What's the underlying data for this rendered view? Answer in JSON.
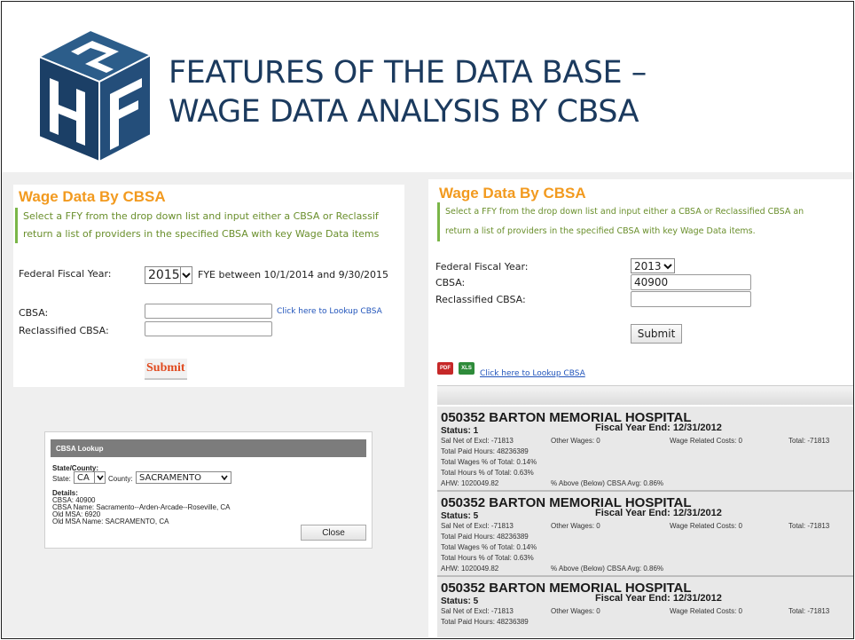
{
  "slide": {
    "title_line1": "FEATURES OF THE DATA BASE –",
    "title_line2": "WAGE DATA ANALYSIS BY CBSA",
    "brand_color": "#1b3a5e",
    "accent_orange": "#f29a1f",
    "accent_green": "#7ab648"
  },
  "panel_a": {
    "heading": "Wage Data By CBSA",
    "desc_line1": "Select a FFY from the drop down list and input either a CBSA or Reclassif",
    "desc_line2": "return a list of providers in the specified CBSA with key Wage Data items",
    "ffy_label": "Federal Fiscal Year:",
    "ffy_value": "2015",
    "fye_note": "FYE between 10/1/2014 and 9/30/2015",
    "cbsa_label": "CBSA:",
    "cbsa_value": "",
    "lookup_link": "Click here to Lookup CBSA",
    "reclass_label": "Reclassified CBSA:",
    "reclass_value": "",
    "submit_label": "Submit"
  },
  "panel_b": {
    "header": "CBSA Lookup",
    "state_county_label": "State/County:",
    "state_label": "State:",
    "state_value": "CA",
    "county_label": "County:",
    "county_value": "SACRAMENTO",
    "details_label": "Details:",
    "details": [
      "CBSA: 40900",
      "CBSA Name: Sacramento--Arden-Arcade--Roseville, CA",
      "Old MSA: 6920",
      "Old MSA Name: SACRAMENTO, CA"
    ],
    "close_label": "Close"
  },
  "panel_c": {
    "heading": "Wage Data By CBSA",
    "desc_line1": "Select a FFY from the drop down list and input either a CBSA or Reclassified CBSA an",
    "desc_line2": "return a list of providers in the specified CBSA with key Wage Data items.",
    "ffy_label": "Federal Fiscal Year:",
    "ffy_value": "2013",
    "cbsa_label": "CBSA:",
    "cbsa_value": "40900",
    "reclass_label": "Reclassified CBSA:",
    "reclass_value": "",
    "submit_label": "Submit",
    "pdf_icon": "PDF",
    "xls_icon": "XLS",
    "lookup_link": "Click here to Lookup CBSA",
    "hospitals": [
      {
        "name": "050352 BARTON MEMORIAL HOSPITAL",
        "status": "Status: 1",
        "fye": "Fiscal Year End: 12/31/2012",
        "sal_net": "Sal Net of Excl: -71813",
        "other_wages": "Other Wages: 0",
        "wage_related": "Wage Related Costs: 0",
        "total": "Total: -71813",
        "paid_hours": "Total Paid Hours: 48236389",
        "wages_pct": "Total Wages % of Total: 0.14%",
        "hours_pct": "Total Hours % of Total: 0.63%",
        "ahw": "AHW: 1020049.82",
        "pct_above": "% Above (Below) CBSA Avg: 0.86%"
      },
      {
        "name": "050352 BARTON MEMORIAL HOSPITAL",
        "status": "Status: 5",
        "fye": "Fiscal Year End: 12/31/2012",
        "sal_net": "Sal Net of Excl: -71813",
        "other_wages": "Other Wages: 0",
        "wage_related": "Wage Related Costs: 0",
        "total": "Total: -71813",
        "paid_hours": "Total Paid Hours: 48236389",
        "wages_pct": "Total Wages % of Total: 0.14%",
        "hours_pct": "Total Hours % of Total: 0.63%",
        "ahw": "AHW: 1020049.82",
        "pct_above": "% Above (Below) CBSA Avg: 0.86%"
      },
      {
        "name": "050352 BARTON MEMORIAL HOSPITAL",
        "status": "Status: 5",
        "fye": "Fiscal Year End: 12/31/2012",
        "sal_net": "Sal Net of Excl: -71813",
        "other_wages": "Other Wages: 0",
        "wage_related": "Wage Related Costs: 0",
        "total": "Total: -71813",
        "paid_hours": "Total Paid Hours: 48236389",
        "wages_pct": "",
        "hours_pct": "",
        "ahw": "",
        "pct_above": ""
      }
    ]
  }
}
